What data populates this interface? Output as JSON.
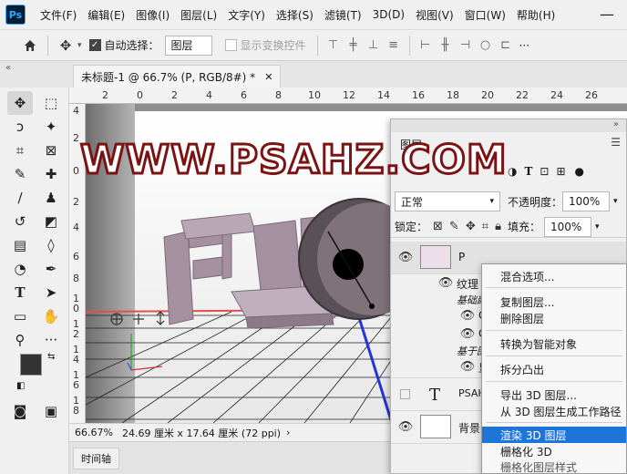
{
  "menu": {
    "items": [
      "文件(F)",
      "编辑(E)",
      "图像(I)",
      "图层(L)",
      "文字(Y)",
      "选择(S)",
      "滤镜(T)",
      "3D(D)",
      "视图(V)",
      "窗口(W)",
      "帮助(H)"
    ],
    "app_logo": "Ps",
    "minimize": "—"
  },
  "options": {
    "auto_select_label": "自动选择：",
    "auto_select_value": "图层",
    "show_transform_label": "显示变换控件",
    "more": "···"
  },
  "tabs": {
    "doc_title": "未标题-1 @ 66.7% (P, RGB/8#) *",
    "collapse": "«"
  },
  "rulers": {
    "h_ticks": [
      "2",
      "0",
      "2",
      "4",
      "6",
      "8",
      "10",
      "12",
      "14",
      "16",
      "18",
      "20",
      "22",
      "24",
      "26"
    ],
    "v_ticks": [
      "4",
      "2",
      "0",
      "2",
      "4",
      "6",
      "8",
      "1\n0",
      "1\n2",
      "1\n4",
      "1\n6",
      "1\n8"
    ]
  },
  "status": {
    "zoom": "66.67%",
    "doc_info": "24.69 厘米 x 17.64 厘米 (72 ppi)",
    "more": "›"
  },
  "timeline": {
    "label": "时间轴"
  },
  "layers": {
    "tab_label": "图层",
    "blend_mode": "正常",
    "opacity_label": "不透明度：",
    "opacity_value": "100%",
    "lock_label": "锁定：",
    "fill_label": "填充：",
    "fill_value": "100%",
    "items": [
      {
        "name": "P",
        "visible": true
      },
      {
        "name": "纹理",
        "visible": true
      },
      {
        "name": "基础颜色",
        "visible": false
      },
      {
        "name": "C",
        "visible": true
      },
      {
        "name": "C",
        "visible": true
      },
      {
        "name": "基于图像",
        "visible": false
      },
      {
        "name": "显",
        "visible": true
      },
      {
        "name": "PSAH",
        "visible": false
      },
      {
        "name": "背景",
        "visible": true
      }
    ]
  },
  "context_menu": {
    "items": [
      "混合选项...",
      "复制图层...",
      "删除图层",
      "转换为智能对象",
      "拆分凸出",
      "导出 3D 图层...",
      "从 3D 图层生成工作路径",
      "渲染 3D 图层",
      "栅格化 3D",
      "栅格化图层样式"
    ],
    "highlighted_index": 7
  },
  "watermark": {
    "text": "WWW.PSAHZ.COM"
  },
  "colors": {
    "accent": "#1d75d8",
    "watermark_stroke": "#7a1414",
    "text3d": "#a4909f"
  }
}
